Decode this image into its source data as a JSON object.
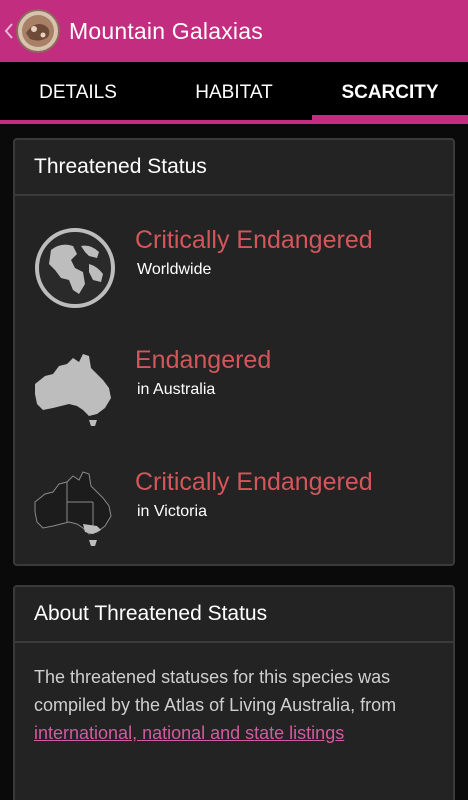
{
  "actionbar": {
    "title": "Mountain Galaxias",
    "up_icon": "chevron-left-icon",
    "app_icon": "app-logo-icon",
    "color": "#c32d80"
  },
  "tabs": [
    {
      "label": "DETAILS",
      "active": false
    },
    {
      "label": "HABITAT",
      "active": false
    },
    {
      "label": "SCARCITY",
      "active": true
    }
  ],
  "threatened_card": {
    "title": "Threatened Status",
    "items": [
      {
        "status": "Critically Endangered",
        "scope": "Worldwide",
        "icon": "globe-icon"
      },
      {
        "status": "Endangered",
        "scope": "in Australia",
        "icon": "australia-map-icon"
      },
      {
        "status": "Critically Endangered",
        "scope": "in Victoria",
        "icon": "victoria-map-icon"
      }
    ],
    "status_color": "#d3565b"
  },
  "about_card": {
    "title": "About Threatened Status",
    "text": "The threatened statuses for this species was compiled by the Atlas of Living Australia, from",
    "link": "international, national and state listings"
  }
}
